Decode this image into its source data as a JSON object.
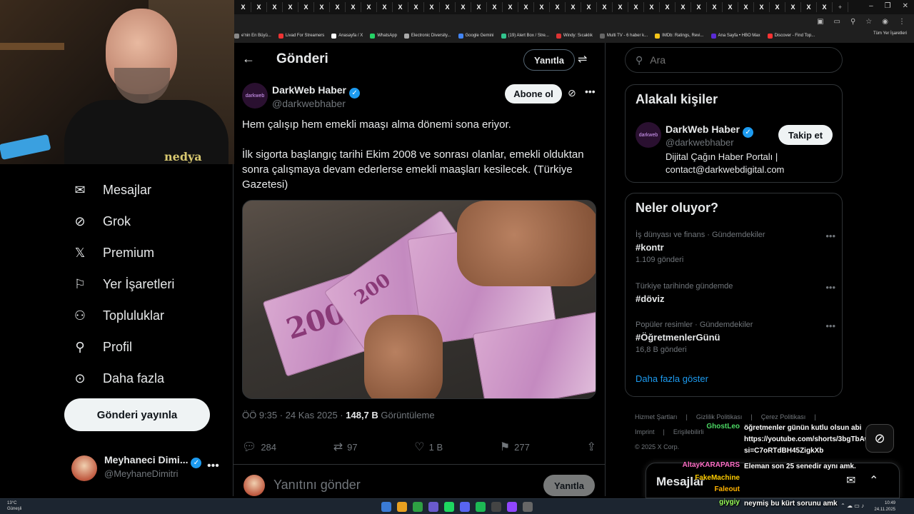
{
  "webcam": {
    "shirt_text": "nedya"
  },
  "browser": {
    "tab_glyph": "X",
    "new_tab": "+",
    "win_controls": [
      "–",
      "❐",
      "✕"
    ],
    "bookmarks": [
      "e'nin En Büyü...",
      "Livad For Streamers",
      "Anasayfa / X",
      "WhatsApp",
      "Electronic Diversity...",
      "Google Gemini",
      "(19) Alert Box / Stre...",
      "Windy: Sıcaklık",
      "Multi TV - 6 haber k...",
      "IMDb: Ratings, Revi...",
      "Ana Sayfa • HBO Max",
      "Discover - Find Top..."
    ],
    "bookmarks_all": "Tüm Yer İşaretleri"
  },
  "nav": {
    "items": [
      {
        "label": "Mesajlar",
        "icon": "mail-icon"
      },
      {
        "label": "Grok",
        "icon": "grok-icon"
      },
      {
        "label": "Premium",
        "icon": "x-logo-icon"
      },
      {
        "label": "Yer İşaretleri",
        "icon": "bookmark-icon"
      },
      {
        "label": "Topluluklar",
        "icon": "communities-icon"
      },
      {
        "label": "Profil",
        "icon": "profile-icon"
      },
      {
        "label": "Daha fazla",
        "icon": "more-circle-icon"
      }
    ],
    "post_button": "Gönderi yayınla",
    "profile": {
      "name": "Meyhaneci Dimi...",
      "handle": "@MeyhaneDimitri",
      "more": "•••"
    }
  },
  "post": {
    "header_title": "Gönderi",
    "reply_label": "Yanıtla",
    "author": {
      "name": "DarkWeb Haber",
      "handle": "@darkwebhaber",
      "avatar_text": "darkweb"
    },
    "subscribe_label": "Abone ol",
    "text_p1": "Hem çalışıp hem emekli maaşı alma dönemi sona eriyor.",
    "text_p2": "İlk sigorta başlangıç tarihi Ekim 2008 ve sonrası olanlar, emekli olduktan sonra çalışmaya devam ederlerse emekli maaşları kesilecek. (Türkiye Gazetesi)",
    "image_note_value": "200",
    "time": "ÖÖ 9:35 · 24 Kas 2025 · ",
    "views_count": "148,7 B",
    "views_label": " Görüntüleme",
    "stats": {
      "replies": "284",
      "reposts": "97",
      "likes": "1 B",
      "bookmarks": "277"
    },
    "reply_placeholder": "Yanıtını gönder",
    "reply_button": "Yanıtla"
  },
  "sidebar": {
    "search_placeholder": "Ara",
    "related": {
      "title": "Alakalı kişiler",
      "name": "DarkWeb Haber",
      "handle": "@darkwebhaber",
      "bio": "Dijital Çağın Haber Portalı | contact@darkwebdigital.com",
      "follow": "Takip et",
      "avatar_text": "darkweb"
    },
    "trends": {
      "title": "Neler oluyor?",
      "items": [
        {
          "context": "İş dünyası ve finans · Gündemdekiler",
          "tag": "#kontr",
          "count": "1.109 gönderi"
        },
        {
          "context": "Türkiye tarihinde gündemde",
          "tag": "#döviz",
          "count": ""
        },
        {
          "context": "Popüler resimler · Gündemdekiler",
          "tag": "#ÖğretmenlerGünü",
          "count": "16,8 B gönderi"
        }
      ],
      "show_more": "Daha fazla göster"
    },
    "footer": [
      "Hizmet Şartları",
      "|",
      "Gizlilik Politikası",
      "|",
      "Çerez Politikası",
      "|",
      "Imprint",
      "|",
      "Erişilebilirli",
      "© 2025 X Corp."
    ]
  },
  "messages_drawer": {
    "title": "Mesajlar"
  },
  "chat": [
    {
      "user": "GhostLeo",
      "color": "#4cd964",
      "msg": "öğretmenler günün kutlu olsun abi https://youtube.com/shorts/3bgTbAwE30?si=C7oRTdBH45ZigkXb"
    },
    {
      "user": "AltayKARAPARS",
      "color": "#ff6ec7",
      "msg": "Eleman son 25 senedir aynı amk."
    },
    {
      "user": "FakeMachine",
      "color": "#ffcc00",
      "msg": ""
    },
    {
      "user": "Faleout",
      "color": "#ffb300",
      "msg": ""
    },
    {
      "user": "giygiy",
      "color": "#9aff5a",
      "msg": "neymiş bu kürt sorunu amk"
    }
  ],
  "taskbar": {
    "weather": "13°C",
    "weather_desc": "Güneşli",
    "time": "10:49",
    "date": "24.11.2025",
    "icon_colors": [
      "#3a7bd5",
      "#e8a020",
      "#2ea043",
      "#6a5acd",
      "#1ed760",
      "#5865f2",
      "#1db954",
      "#444",
      "#9146ff",
      "#666"
    ]
  }
}
